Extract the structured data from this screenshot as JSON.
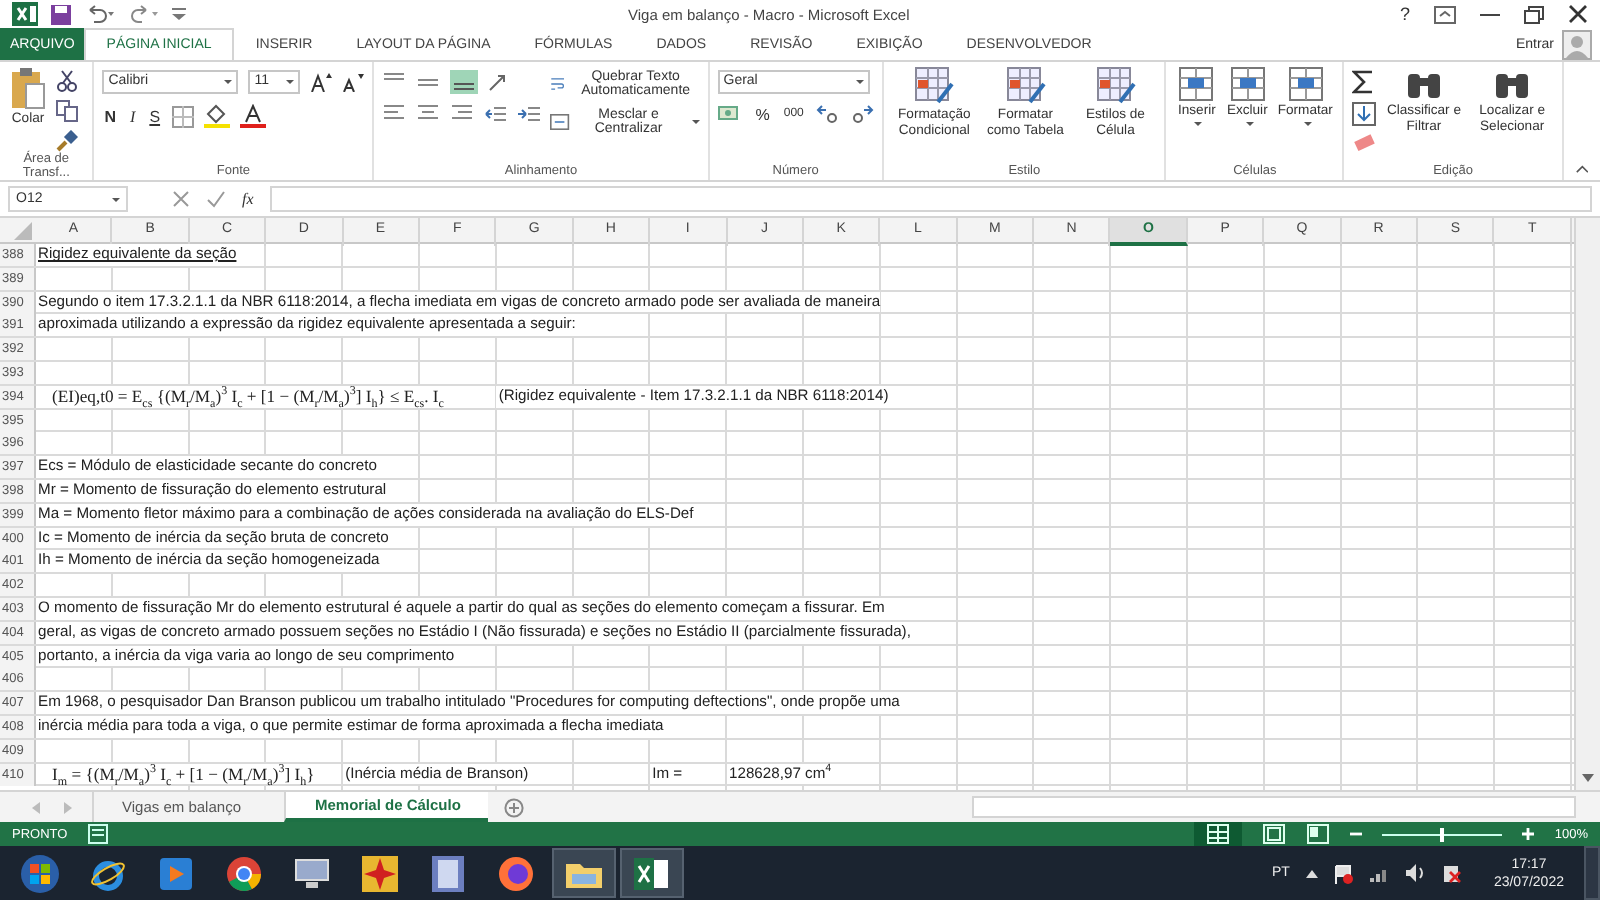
{
  "window": {
    "title": "Viga em balanço - Macro - Microsoft Excel",
    "help": "?",
    "user": "Entrar"
  },
  "tabs": [
    {
      "label": "ARQUIVO",
      "kind": "file",
      "selected": false
    },
    {
      "label": "PÁGINA INICIAL",
      "kind": "tab",
      "selected": true
    },
    {
      "label": "INSERIR",
      "kind": "tab",
      "selected": false
    },
    {
      "label": "LAYOUT DA PÁGINA",
      "kind": "tab",
      "selected": false
    },
    {
      "label": "FÓRMULAS",
      "kind": "tab",
      "selected": false
    },
    {
      "label": "DADOS",
      "kind": "tab",
      "selected": false
    },
    {
      "label": "REVISÃO",
      "kind": "tab",
      "selected": false
    },
    {
      "label": "EXIBIÇÃO",
      "kind": "tab",
      "selected": false
    },
    {
      "label": "DESENVOLVEDOR",
      "kind": "tab",
      "selected": false
    }
  ],
  "ribbon": {
    "clipboard": {
      "label": "Área de Transf...",
      "paste": "Colar"
    },
    "font": {
      "label": "Fonte",
      "name": "Calibri",
      "size": "11",
      "bold": "N",
      "italic": "I",
      "underline": "S"
    },
    "alignment": {
      "label": "Alinhamento",
      "wrap": "Quebrar Texto Automaticamente",
      "merge": "Mesclar e Centralizar"
    },
    "number": {
      "label": "Número",
      "format": "Geral",
      "percent": "%",
      "thousands": "000"
    },
    "styles": {
      "label": "Estilo",
      "buttons": [
        "Formatação Condicional",
        "Formatar como Tabela",
        "Estilos de Célula"
      ]
    },
    "cells": {
      "label": "Células",
      "buttons": [
        "Inserir",
        "Excluir",
        "Formatar"
      ]
    },
    "editing": {
      "label": "Edição",
      "buttons": [
        "Classificar e Filtrar",
        "Localizar e Selecionar"
      ]
    }
  },
  "formula_bar": {
    "name_box": "O12",
    "fx": "fx"
  },
  "sheet": {
    "columns": [
      {
        "label": "A",
        "selected": false
      },
      {
        "label": "B",
        "selected": false
      },
      {
        "label": "C",
        "selected": false
      },
      {
        "label": "D",
        "selected": false
      },
      {
        "label": "E",
        "selected": false
      },
      {
        "label": "F",
        "selected": false
      },
      {
        "label": "G",
        "selected": false
      },
      {
        "label": "H",
        "selected": false
      },
      {
        "label": "I",
        "selected": false
      },
      {
        "label": "J",
        "selected": false
      },
      {
        "label": "K",
        "selected": false
      },
      {
        "label": "L",
        "selected": false
      },
      {
        "label": "M",
        "selected": false
      },
      {
        "label": "N",
        "selected": false
      },
      {
        "label": "O",
        "selected": true
      },
      {
        "label": "P",
        "selected": false
      },
      {
        "label": "Q",
        "selected": false
      },
      {
        "label": "R",
        "selected": false
      },
      {
        "label": "S",
        "selected": false
      },
      {
        "label": "T",
        "selected": false
      }
    ],
    "rows": [
      {
        "number": "388",
        "cells": [
          {
            "kind": "heading",
            "text": "Rigidez equivalente da seção"
          }
        ]
      },
      {
        "number": "389"
      },
      {
        "number": "390",
        "cells": [
          {
            "kind": "text",
            "text": "Segundo o item 17.3.2.1.1 da NBR 6118:2014, a flecha imediata em vigas de concreto armado pode ser avaliada de maneira"
          }
        ]
      },
      {
        "number": "391",
        "cells": [
          {
            "kind": "text",
            "text": "aproximada utilizando a expressão da rigidez equivalente apresentada a seguir:"
          }
        ]
      },
      {
        "number": "392"
      },
      {
        "number": "393"
      },
      {
        "number": "394",
        "cells": [
          {
            "kind": "formula",
            "text": "(EI)eq,t0 = E$_{cs}$ {(M$_{r}$/M$_{a}$)$^{3}$ I$_{c}$ + [1 − (M$_{r}$/M$_{a}$)$^{3}$] I$_{h}$} ≤ E$_{cs}$. I$_{c}$"
          },
          null,
          null,
          null,
          null,
          null,
          {
            "kind": "text",
            "text": "(Rigidez equivalente - Item 17.3.2.1.1 da NBR 6118:2014)"
          }
        ]
      },
      {
        "number": "395"
      },
      {
        "number": "396"
      },
      {
        "number": "397",
        "cells": [
          {
            "kind": "text",
            "text": "Ecs = Módulo de elasticidade secante do concreto"
          }
        ]
      },
      {
        "number": "398",
        "cells": [
          {
            "kind": "text",
            "text": "Mr = Momento de fissuração do elemento estrutural"
          }
        ]
      },
      {
        "number": "399",
        "cells": [
          {
            "kind": "text",
            "text": "Ma = Momento fletor máximo para a combinação de ações considerada na avaliação do ELS-Def"
          }
        ]
      },
      {
        "number": "400",
        "cells": [
          {
            "kind": "text",
            "text": "Ic = Momento de inércia da seção bruta de concreto"
          }
        ]
      },
      {
        "number": "401",
        "cells": [
          {
            "kind": "text",
            "text": "Ih = Momento de inércia da seção homogeneizada"
          }
        ]
      },
      {
        "number": "402"
      },
      {
        "number": "403",
        "cells": [
          {
            "kind": "text",
            "text": "O momento de fissuração Mr do elemento estrutural é aquele a partir do qual as seções do elemento começam a fissurar. Em"
          }
        ]
      },
      {
        "number": "404",
        "cells": [
          {
            "kind": "text",
            "text": "geral, as vigas de concreto armado possuem seções no Estádio I (Não fissurada) e seções no Estádio II (parcialmente fissurada),"
          }
        ]
      },
      {
        "number": "405",
        "cells": [
          {
            "kind": "text",
            "text": "portanto, a inércia da viga varia ao longo de seu comprimento"
          }
        ]
      },
      {
        "number": "406"
      },
      {
        "number": "407",
        "cells": [
          {
            "kind": "text",
            "text": "Em 1968, o pesquisador Dan Branson publicou um trabalho intitulado \"Procedures for computing deftections\", onde propõe uma"
          }
        ]
      },
      {
        "number": "408",
        "cells": [
          {
            "kind": "text",
            "text": "inércia média para toda a viga, o que permite estimar de forma aproximada a flecha imediata"
          }
        ]
      },
      {
        "number": "409"
      },
      {
        "number": "410",
        "cells": [
          {
            "kind": "formula",
            "text": "I$_{m}$ = {(M$_{r}$/M$_{a}$)$^{3}$ I$_{c}$ + [1 − (M$_{r}$/M$_{a}$)$^{3}$] I$_{h}$}"
          },
          null,
          null,
          null,
          {
            "kind": "text",
            "text": "(Inércia média de Branson)"
          },
          null,
          null,
          null,
          {
            "kind": "text",
            "text": "Im ="
          },
          {
            "kind": "text",
            "text": "128628,97 cm$^{4}$"
          }
        ]
      }
    ]
  },
  "sheet_tabs": [
    {
      "label": "Vigas em balanço",
      "selected": false
    },
    {
      "label": "Memorial de Cálculo",
      "selected": true
    }
  ],
  "status_bar": {
    "status": "PRONTO",
    "zoom": "100%",
    "zoom_slider": {
      "level": 0.5
    }
  },
  "taskbar": {
    "apps": [
      {
        "kind": "start",
        "active": false
      },
      {
        "kind": "ie",
        "active": false
      },
      {
        "kind": "media",
        "active": false
      },
      {
        "kind": "chrome",
        "active": false
      },
      {
        "kind": "network",
        "active": false
      },
      {
        "kind": "star",
        "active": false
      },
      {
        "kind": "film",
        "active": false
      },
      {
        "kind": "firefox",
        "active": false
      },
      {
        "kind": "folder",
        "active": true
      },
      {
        "kind": "excel",
        "active": true
      }
    ],
    "language": "PT",
    "time": "17:17",
    "date": "23/07/2022"
  }
}
